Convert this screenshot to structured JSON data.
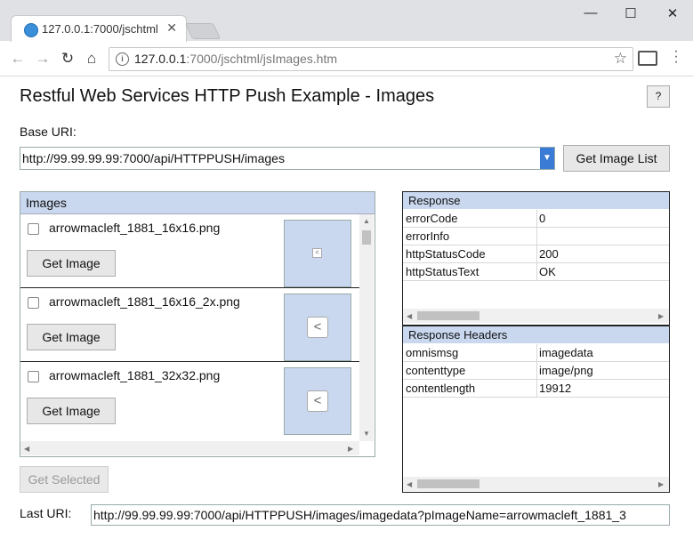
{
  "browser": {
    "tab_title": "127.0.0.1:7000/jschtml/js",
    "tab_close": "✕",
    "url_host": "127.0.0.1",
    "url_path": ":7000/jschtml/jsImages.htm",
    "window_controls": [
      "—",
      "☐",
      "✕"
    ]
  },
  "page": {
    "title": "Restful Web Services HTTP Push Example - Images",
    "help_label": "?",
    "base_uri_label": "Base URI:",
    "base_uri_value": "http://99.99.99.99:7000/api/HTTPPUSH/images",
    "get_image_list_label": "Get Image List",
    "get_selected_label": "Get Selected",
    "last_uri_label": "Last URI:",
    "last_uri_value": "http://99.99.99.99:7000/api/HTTPPUSH/images/imagedata?pImageName=arrowmacleft_1881_3"
  },
  "images": {
    "header": "Images",
    "items": [
      {
        "name": "arrowmacleft_1881_16x16.png",
        "button": "Get Image"
      },
      {
        "name": "arrowmacleft_1881_16x16_2x.png",
        "button": "Get Image"
      },
      {
        "name": "arrowmacleft_1881_32x32.png",
        "button": "Get Image"
      }
    ]
  },
  "response": {
    "header": "Response",
    "rows": [
      {
        "key": "errorCode",
        "value": "0"
      },
      {
        "key": "errorInfo",
        "value": ""
      },
      {
        "key": "httpStatusCode",
        "value": "200"
      },
      {
        "key": "httpStatusText",
        "value": "OK"
      }
    ]
  },
  "response_headers": {
    "header": "Response Headers",
    "rows": [
      {
        "key": "omnismsg",
        "value": "imagedata"
      },
      {
        "key": "contenttype",
        "value": "image/png"
      },
      {
        "key": "contentlength",
        "value": "19912"
      }
    ]
  },
  "colors": {
    "accent": "#3a7bd5",
    "panel_header": "#c9d8ef"
  }
}
